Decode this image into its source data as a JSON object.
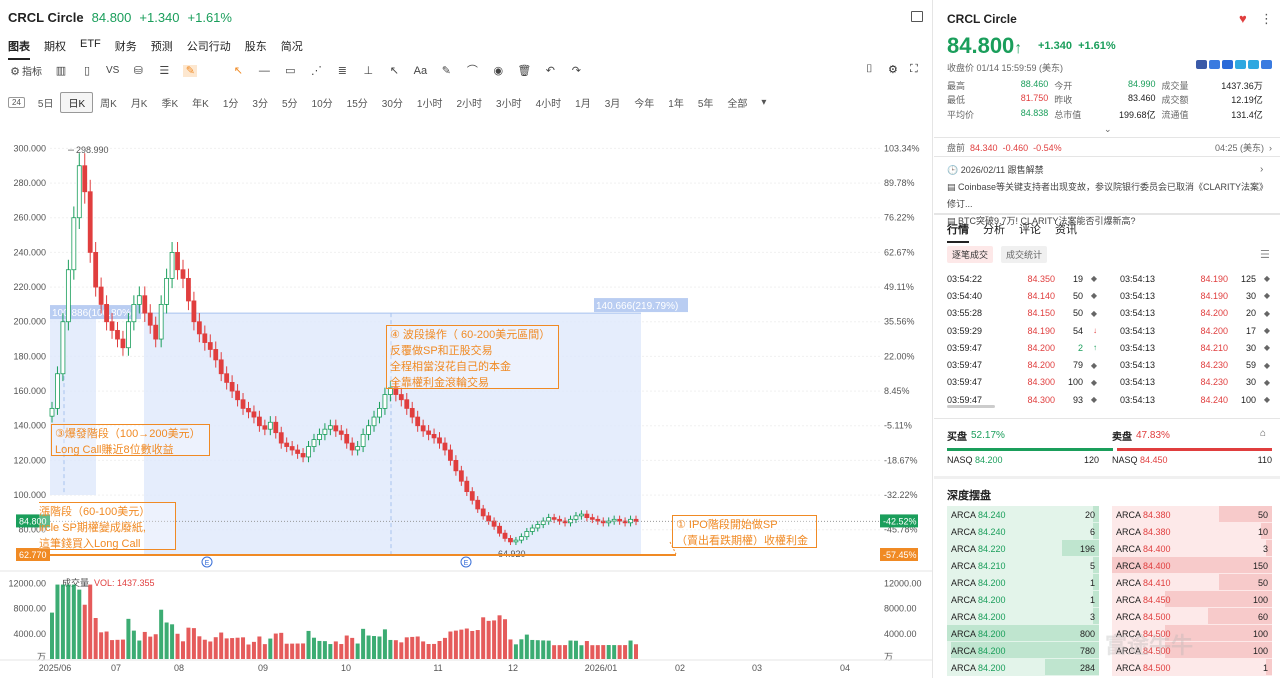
{
  "header": {
    "symbol": "CRCL Circle",
    "price": "84.800",
    "change": "+1.340",
    "pct": "+1.61%"
  },
  "main_tabs": [
    "图表",
    "期权",
    "ETF",
    "财务",
    "预测",
    "公司行动",
    "股东",
    "简况"
  ],
  "toolbar": {
    "indicator_label": "指标",
    "vs_label": "VS"
  },
  "periods": [
    "5日",
    "日K",
    "周K",
    "月K",
    "季K",
    "年K",
    "1分",
    "3分",
    "5分",
    "10分",
    "15分",
    "30分",
    "1小时",
    "2小时",
    "3小时",
    "4小时",
    "1月",
    "3月",
    "今年",
    "1年",
    "5年",
    "全部"
  ],
  "period_badge": "24",
  "chart_data": {
    "type": "candlestick",
    "y_ticks": [
      "300.000",
      "280.000",
      "260.000",
      "240.000",
      "220.000",
      "200.000",
      "180.000",
      "160.000",
      "140.000",
      "120.000",
      "100.000",
      "80.000"
    ],
    "pct_ticks": [
      "103.34%",
      "89.78%",
      "76.22%",
      "62.67%",
      "49.11%",
      "35.56%",
      "22.00%",
      "8.45%",
      "-5.11%",
      "-18.67%",
      "-32.22%",
      "-45.78%"
    ],
    "x_ticks": [
      "2025/06",
      "07",
      "08",
      "09",
      "10",
      "11",
      "12",
      "2026/01",
      "02",
      "03",
      "04"
    ],
    "ylim": [
      66,
      306
    ],
    "high_label": "298.990",
    "low_label": "64.920",
    "current_price_label": "84.800",
    "current_pct_label": "-42.52%",
    "cost_label": "62.770",
    "cost_pct_label": "-57.45%",
    "measure_left_label": "100.886(100.80%)",
    "measure_right_label": "140.666(219.79%)",
    "volume_label": "成交量",
    "volume_value": "VOL: 1437.355",
    "vol_ticks": [
      "12000.00",
      "8000.00",
      "4000.00",
      "万"
    ],
    "vol_ticks_r": [
      "12000.00",
      "8000.00",
      "4000.00",
      "万"
    ],
    "event_marker": "E",
    "closes": [
      150,
      170,
      200,
      230,
      260,
      290,
      275,
      240,
      220,
      210,
      200,
      195,
      190,
      185,
      200,
      210,
      215,
      205,
      198,
      190,
      210,
      225,
      240,
      230,
      225,
      212,
      200,
      193,
      188,
      184,
      178,
      170,
      165,
      160,
      155,
      150,
      148,
      145,
      140,
      138,
      142,
      136,
      130,
      128,
      126,
      124,
      122,
      128,
      132,
      135,
      138,
      140,
      137,
      135,
      130,
      126,
      128,
      135,
      140,
      145,
      150,
      158,
      162,
      158,
      155,
      150,
      145,
      140,
      137,
      135,
      133,
      130,
      126,
      120,
      114,
      108,
      102,
      97,
      92,
      88,
      85,
      82,
      78,
      75,
      73,
      74,
      76,
      79,
      81,
      83,
      85,
      87,
      86,
      85,
      84,
      86,
      88,
      89,
      87,
      86,
      85,
      84,
      85,
      86,
      85,
      84,
      86,
      84.8
    ]
  },
  "annotations": {
    "a1": [
      "① IPO階段開始做SP",
      "（賣出看跌期權）收權利金"
    ],
    "a2": [
      "漲階段（60-100美元）",
      "ircle SP期權變成廢紙,",
      "這筆錢買入Long Call"
    ],
    "a3": [
      "③爆發階段（100→200美元）",
      "Long Call賺近8位數收益"
    ],
    "a4": [
      "④ 波段操作（ 60-200美元區間）",
      "反覆做SP和正股交易",
      "全程相當沒花自己的本金",
      "全靠權利金滾輪交易"
    ]
  },
  "right": {
    "title": "CRCL  Circle",
    "price": "84.800",
    "arrow": "↑",
    "change": "+1.340",
    "pct": "+1.61%",
    "time": "收盘价 01/14 15:59:59 (美东)",
    "stats": [
      [
        [
          "最高",
          "88.460"
        ],
        [
          "今开",
          "84.990"
        ],
        [
          "成交量",
          "1437.36万"
        ]
      ],
      [
        [
          "最低",
          "81.750"
        ],
        [
          "昨收",
          "83.460"
        ],
        [
          "成交额",
          "12.19亿"
        ]
      ],
      [
        [
          "平均价",
          "84.838"
        ],
        [
          "总市值",
          "199.68亿"
        ],
        [
          "流通值",
          "131.4亿"
        ]
      ]
    ],
    "premarket": {
      "label": "盘前",
      "price": "84.340",
      "chg": "-0.460",
      "pct": "-0.54%",
      "time": "04:25 (美东)"
    },
    "news": [
      "2026/02/11 跟售解禁",
      "Coinbase等关键支持者出现变故，参议院银行委员会已取消《CLARITY法案》修订...",
      "BTC突破9.7万! CLARITY法案能否引爆新高?"
    ],
    "tabs": [
      "行情",
      "分析",
      "评论",
      "资讯"
    ],
    "sub_tabs": [
      "逐笔成交",
      "成交统计"
    ],
    "ticks_left": [
      [
        "03:54:22",
        "84.350",
        "19",
        "◆"
      ],
      [
        "03:54:40",
        "84.140",
        "50",
        "◆"
      ],
      [
        "03:55:28",
        "84.150",
        "50",
        "◆"
      ],
      [
        "03:59:29",
        "84.190",
        "54",
        "↓"
      ],
      [
        "03:59:47",
        "84.200",
        "2",
        "↑"
      ],
      [
        "03:59:47",
        "84.200",
        "79",
        "◆"
      ],
      [
        "03:59:47",
        "84.300",
        "100",
        "◆"
      ],
      [
        "03:59:47",
        "84.300",
        "93",
        "◆"
      ]
    ],
    "ticks_right": [
      [
        "03:54:13",
        "84.190",
        "125",
        "◆"
      ],
      [
        "03:54:13",
        "84.190",
        "30",
        "◆"
      ],
      [
        "03:54:13",
        "84.200",
        "20",
        "◆"
      ],
      [
        "03:54:13",
        "84.200",
        "17",
        "◆"
      ],
      [
        "03:54:13",
        "84.210",
        "30",
        "◆"
      ],
      [
        "03:54:13",
        "84.230",
        "59",
        "◆"
      ],
      [
        "03:54:13",
        "84.230",
        "30",
        "◆"
      ],
      [
        "03:54:13",
        "84.240",
        "100",
        "◆"
      ]
    ],
    "buy_label": "买盘",
    "buy_pct": "52.17%",
    "sell_label": "卖盘",
    "sell_pct": "47.83%",
    "buy_fraction": 0.5217,
    "nasq_bid": [
      "NASQ",
      "84.200",
      "120"
    ],
    "nasq_ask": [
      "NASQ",
      "84.450",
      "110"
    ],
    "depth_title": "深度摆盘",
    "bids": [
      [
        "ARCA",
        "84.240",
        "20"
      ],
      [
        "ARCA",
        "84.240",
        "6"
      ],
      [
        "ARCA",
        "84.220",
        "196"
      ],
      [
        "ARCA",
        "84.210",
        "5"
      ],
      [
        "ARCA",
        "84.200",
        "1"
      ],
      [
        "ARCA",
        "84.200",
        "1"
      ],
      [
        "ARCA",
        "84.200",
        "3"
      ],
      [
        "ARCA",
        "84.200",
        "800"
      ],
      [
        "ARCA",
        "84.200",
        "780"
      ],
      [
        "ARCA",
        "84.200",
        "284"
      ]
    ],
    "asks": [
      [
        "ARCA",
        "84.380",
        "50"
      ],
      [
        "ARCA",
        "84.380",
        "10"
      ],
      [
        "ARCA",
        "84.400",
        "3"
      ],
      [
        "ARCA",
        "84.400",
        "150"
      ],
      [
        "ARCA",
        "84.410",
        "50"
      ],
      [
        "ARCA",
        "84.450",
        "100"
      ],
      [
        "ARCA",
        "84.500",
        "60"
      ],
      [
        "ARCA",
        "84.500",
        "100"
      ],
      [
        "ARCA",
        "84.500",
        "100"
      ],
      [
        "ARCA",
        "84.500",
        "1"
      ]
    ],
    "watermark": "富途牛牛"
  },
  "colors": {
    "up": "#1a9e5b",
    "down": "#e03e3e",
    "accent": "#f08a24",
    "highlight": "#dfe8fb"
  }
}
